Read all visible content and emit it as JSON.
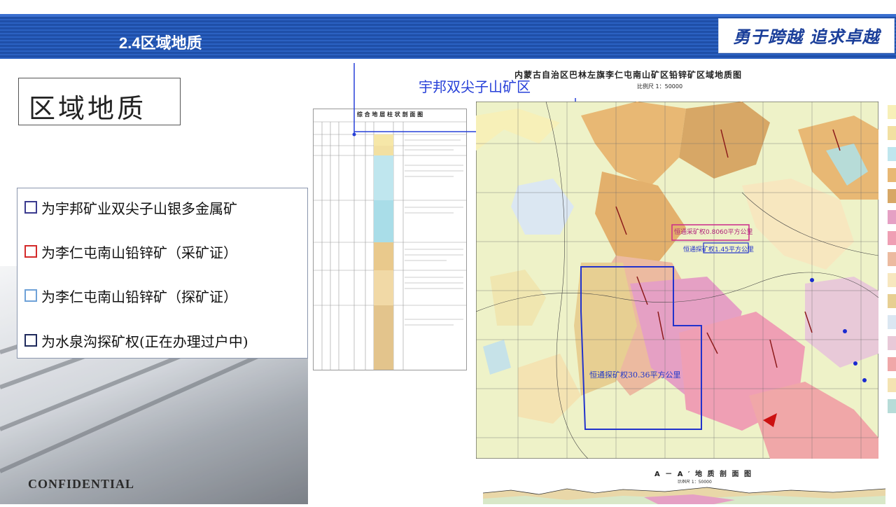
{
  "header": {
    "title": "2.4区域地质",
    "slogan": "勇于跨越 追求卓越"
  },
  "title_box": {
    "text": "区域地质"
  },
  "legend": {
    "items": [
      {
        "label": "为宇邦矿业双尖子山银多金属矿",
        "color": "#3b3b8f"
      },
      {
        "label": "为李仁屯南山铅锌矿（采矿证）",
        "color": "#d42a2a"
      },
      {
        "label": "为李仁屯南山铅锌矿（探矿证）",
        "color": "#6fa2d8"
      },
      {
        "label": "为水泉沟探矿权(正在办理过户中)",
        "color": "#1f2a5c"
      }
    ]
  },
  "footer": {
    "confidential": "CONFIDENTIAL"
  },
  "strat_column": {
    "title": "综 合 地 层 柱 状 剖 面 图"
  },
  "map": {
    "title": "内蒙古自治区巴林左旗李仁屯南山矿区铅锌矿区域地质图",
    "scale": "比例尺 1：50000",
    "callout_label": "宇邦双尖子山矿区",
    "box_label_blue": "恒通探矿权30.36平方公里",
    "box_label_pink_1": "恒通采矿权0.8060平方公里",
    "box_label_pink_2": "恒通探矿权1.45平方公里"
  },
  "section": {
    "title": "A － A ′ 地 质 剖 面 图",
    "scale": "比例尺 1：50000"
  },
  "colors": {
    "header_blue": "#1f4fa8",
    "slogan_blue": "#1b3f9a",
    "callout_blue": "#2740d8",
    "map_bg": "#eef2c8"
  }
}
